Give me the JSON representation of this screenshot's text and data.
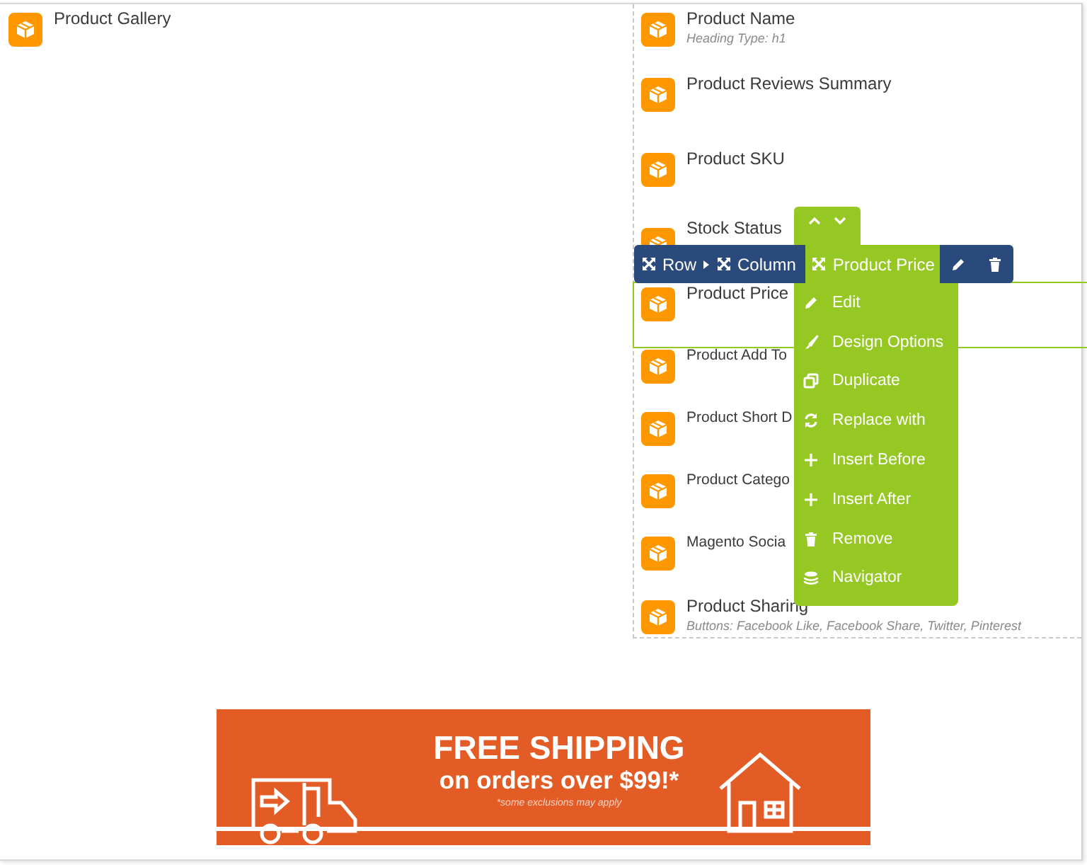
{
  "left_column": {
    "elements": [
      {
        "title": "Product Gallery"
      }
    ]
  },
  "right_column": {
    "elements": [
      {
        "title": "Product Name",
        "subtitle": "Heading Type: h1",
        "selected": false
      },
      {
        "title": "Product Reviews Summary",
        "selected": false
      },
      {
        "title": "Product SKU",
        "selected": false
      },
      {
        "title": "Stock Status",
        "selected": false
      },
      {
        "title": "Product Price",
        "selected": true
      },
      {
        "title": "Product Add To",
        "selected": false
      },
      {
        "title": "Product Short D",
        "selected": false
      },
      {
        "title": "Product Catego",
        "selected": false
      },
      {
        "title": "Magento Socia",
        "selected": false
      },
      {
        "title": "Product Sharing",
        "subtitle": "Buttons: Facebook Like, Facebook Share, Twitter, Pinterest",
        "selected": false
      }
    ]
  },
  "toolbar": {
    "breadcrumbs": [
      "Row",
      "Column"
    ],
    "current": "Product Price"
  },
  "context_menu": {
    "items": [
      {
        "label": "Edit",
        "kind": "pencil"
      },
      {
        "label": "Design Options",
        "kind": "brush"
      },
      {
        "label": "Duplicate",
        "kind": "copy"
      },
      {
        "label": "Replace with",
        "kind": "refresh"
      },
      {
        "label": "Insert Before",
        "kind": "plus"
      },
      {
        "label": "Insert After",
        "kind": "plus"
      },
      {
        "label": "Remove",
        "kind": "trash"
      },
      {
        "label": "Navigator",
        "kind": "layers"
      }
    ]
  },
  "banner": {
    "headline": "FREE SHIPPING",
    "subline": "on orders over $99!*",
    "note": "*some exclusions may apply"
  }
}
